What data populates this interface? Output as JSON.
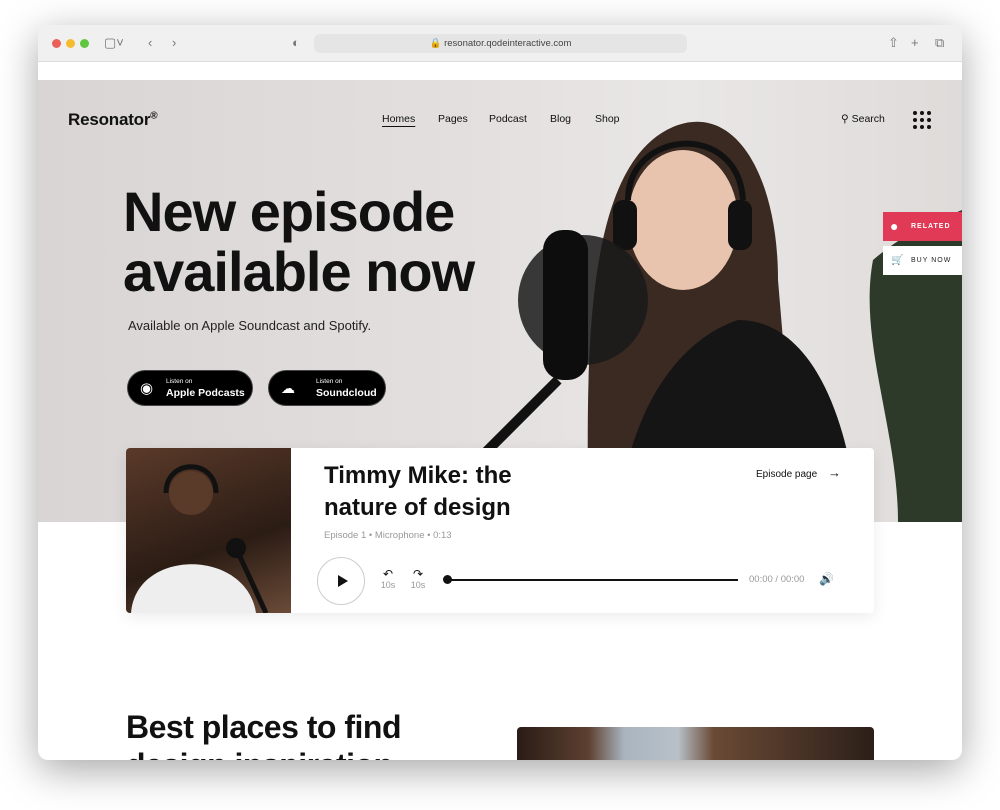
{
  "browser": {
    "url": "resonator.qodeinteractive.com"
  },
  "header": {
    "logo": "Resonator",
    "logo_mark": "®",
    "nav": [
      "Homes",
      "Pages",
      "Podcast",
      "Blog",
      "Shop"
    ],
    "search": "Search"
  },
  "hero": {
    "title_line1": "New episode",
    "title_line2": "available now",
    "subtitle": "Available on Apple Soundcast and Spotify.",
    "buttons": [
      {
        "small": "Listen on",
        "label": "Apple Podcasts"
      },
      {
        "small": "Listen on",
        "label": "Soundcloud"
      }
    ]
  },
  "side": {
    "related": "RELATED",
    "buy": "BUY NOW",
    "accent": "#e03a56"
  },
  "episode": {
    "title_line1": "Timmy Mike: the",
    "title_line2": "nature of design",
    "meta": "Episode 1 • Microphone • 0:13",
    "link": "Episode page",
    "rewind": "10s",
    "forward": "10s",
    "time": "00:00 / 00:00",
    "progress": 0
  },
  "section": {
    "title_line1": "Best places to find",
    "title_line2": "design inspiration"
  }
}
